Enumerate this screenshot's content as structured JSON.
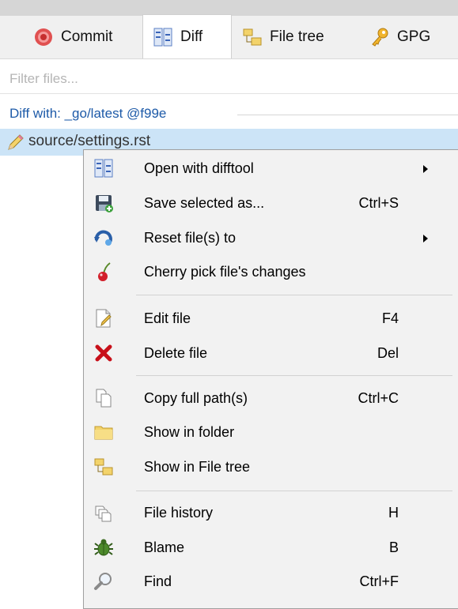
{
  "tabs": [
    {
      "label": "Commit",
      "icon": "commit-icon"
    },
    {
      "label": "Diff",
      "icon": "diff-icon"
    },
    {
      "label": "File tree",
      "icon": "file-tree-icon"
    },
    {
      "label": "GPG",
      "icon": "key-icon"
    }
  ],
  "filter": {
    "placeholder": "Filter files..."
  },
  "diff_with": "Diff with: _go/latest @f99e",
  "selected_file": "source/settings.rst",
  "menu": {
    "items": [
      {
        "label": "Open with difftool",
        "shortcut": "",
        "icon": "difftool-icon",
        "submenu": true
      },
      {
        "label": "Save selected as...",
        "shortcut": "Ctrl+S",
        "icon": "save-icon"
      },
      {
        "label": "Reset file(s) to",
        "shortcut": "",
        "icon": "reset-icon",
        "submenu": true
      },
      {
        "label": "Cherry pick file's changes",
        "shortcut": "",
        "icon": "cherry-icon"
      },
      {
        "label": "Edit file",
        "shortcut": "F4",
        "icon": "edit-file-icon"
      },
      {
        "label": "Delete file",
        "shortcut": "Del",
        "icon": "delete-icon"
      },
      {
        "label": "Copy full path(s)",
        "shortcut": "Ctrl+C",
        "icon": "copy-icon"
      },
      {
        "label": "Show in folder",
        "shortcut": "",
        "icon": "folder-icon"
      },
      {
        "label": "Show in File tree",
        "shortcut": "",
        "icon": "file-tree-icon"
      },
      {
        "label": "File history",
        "shortcut": "H",
        "icon": "history-icon"
      },
      {
        "label": "Blame",
        "shortcut": "B",
        "icon": "blame-bug-icon"
      },
      {
        "label": "Find",
        "shortcut": "Ctrl+F",
        "icon": "find-icon"
      }
    ]
  }
}
